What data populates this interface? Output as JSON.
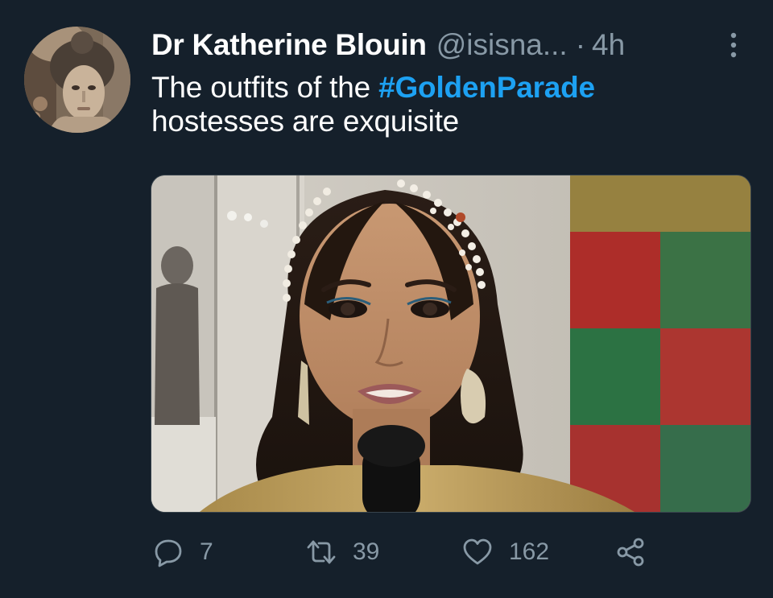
{
  "tweet": {
    "author_name": "Dr Katherine Blouin",
    "handle": "@isisna...",
    "separator": "·",
    "timestamp": "4h",
    "text_before": "The outfits of the ",
    "hashtag": "#GoldenParade",
    "text_after": "hostesses are exquisite"
  },
  "actions": {
    "reply_count": "7",
    "retweet_count": "39",
    "like_count": "162"
  },
  "icons": {
    "more": "more-vertical-icon",
    "reply": "reply-icon",
    "retweet": "retweet-icon",
    "like": "heart-icon",
    "share": "share-icon"
  },
  "colors": {
    "background": "#15202b",
    "text": "#ffffff",
    "secondary": "#8899a6",
    "hashtag": "#1da1f2"
  }
}
